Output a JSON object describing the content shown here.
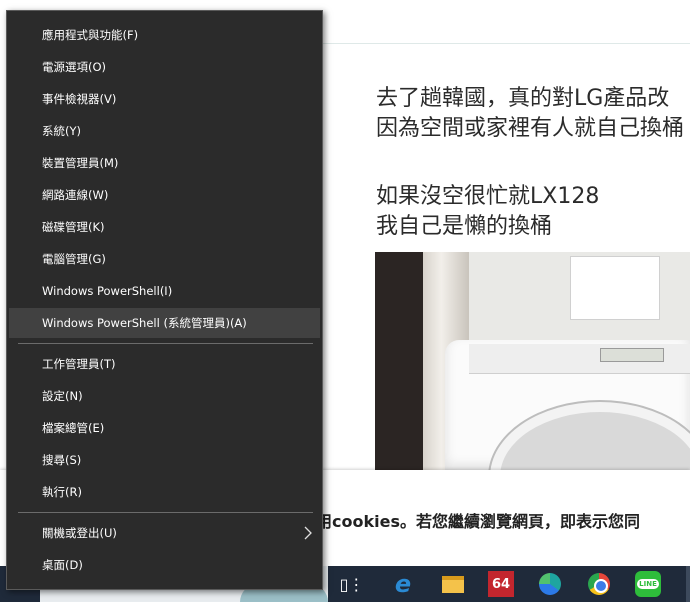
{
  "background_page": {
    "article_lines": [
      "去了趟韓國，真的對LG產品改",
      "因為空間或家裡有人就自己換桶",
      "",
      "如果沒空很忙就LX128",
      "我自己是懶的換桶"
    ],
    "cookie_banner_text": "用cookies。若您繼續瀏覽網頁，即表示您同"
  },
  "winx_menu": {
    "group1": [
      {
        "label": "應用程式與功能(F)"
      },
      {
        "label": "電源選項(O)"
      },
      {
        "label": "事件檢視器(V)"
      },
      {
        "label": "系統(Y)"
      },
      {
        "label": "裝置管理員(M)"
      },
      {
        "label": "網路連線(W)"
      },
      {
        "label": "磁碟管理(K)"
      },
      {
        "label": "電腦管理(G)"
      },
      {
        "label": "Windows PowerShell(I)"
      },
      {
        "label": "Windows PowerShell (系統管理員)(A)",
        "highlighted": true
      }
    ],
    "group2": [
      {
        "label": "工作管理員(T)"
      },
      {
        "label": "設定(N)"
      },
      {
        "label": "檔案總管(E)"
      },
      {
        "label": "搜尋(S)"
      },
      {
        "label": "執行(R)"
      }
    ],
    "group3": [
      {
        "label": "關機或登出(U)",
        "has_submenu": true
      },
      {
        "label": "桌面(D)"
      }
    ]
  },
  "taskbar": {
    "icons": [
      "task-view-icon",
      "internet-explorer-icon",
      "file-explorer-icon",
      "app-64-icon",
      "edge-icon",
      "chrome-icon",
      "line-icon"
    ],
    "app_64_label": "64",
    "line_label": "LINE"
  },
  "colors": {
    "menu_bg": "#2b2b2b",
    "menu_highlight": "#414141",
    "taskbar_bg": "#1f2a3a"
  }
}
